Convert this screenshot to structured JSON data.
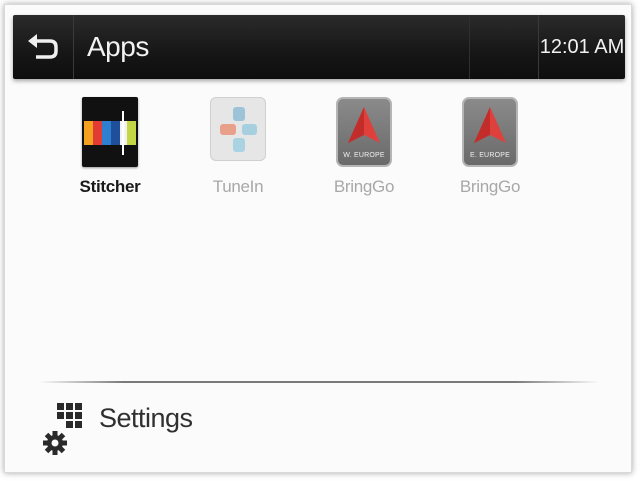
{
  "header": {
    "title": "Apps",
    "clock": "12:01 AM",
    "back_icon": "back-arrow-icon"
  },
  "apps": [
    {
      "label": "Stitcher",
      "state": "enabled",
      "icon": "stitcher-icon"
    },
    {
      "label": "TuneIn",
      "state": "disabled",
      "icon": "tunein-icon"
    },
    {
      "label": "BringGo",
      "state": "disabled",
      "icon": "bringgo-icon",
      "region": "W. EUROPE"
    },
    {
      "label": "BringGo",
      "state": "disabled",
      "icon": "bringgo-icon",
      "region": "E. EUROPE"
    }
  ],
  "footer": {
    "settings_label": "Settings",
    "settings_icon": "settings-grid-gear-icon"
  },
  "colors": {
    "header_bg": "#161616",
    "text_active": "#1a1a1a",
    "text_disabled": "#a8a8a8",
    "bringgo_red": "#e0403c"
  }
}
